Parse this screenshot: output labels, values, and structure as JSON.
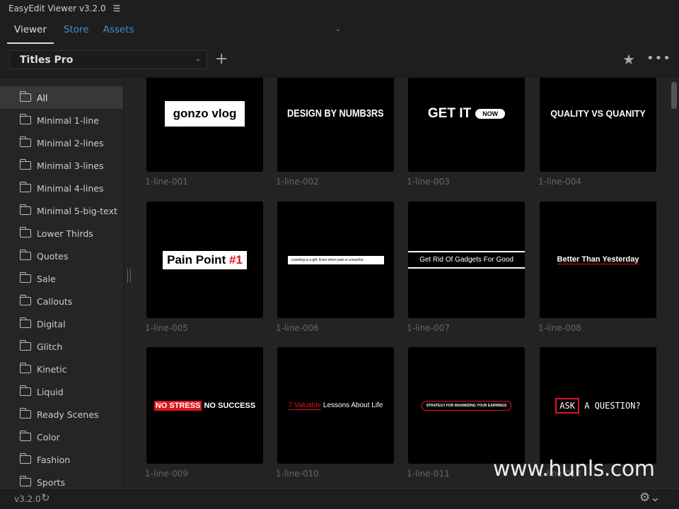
{
  "app": {
    "title": "EasyEdit Viewer v3.2.0",
    "version": "v3.2.0"
  },
  "tabs": [
    {
      "label": "Viewer",
      "active": true
    },
    {
      "label": "Store"
    },
    {
      "label": "Assets"
    }
  ],
  "toolbar": {
    "collection": "Titles Pro"
  },
  "sidebar": {
    "items": [
      "All",
      "Minimal 1-line",
      "Minimal 2-lines",
      "Minimal 3-lines",
      "Minimal 4-lines",
      "Minimal 5-big-text",
      "Lower Thirds",
      "Quotes",
      "Sale",
      "Callouts",
      "Digital",
      "Glitch",
      "Kinetic",
      "Liquid",
      "Ready Scenes",
      "Color",
      "Fashion",
      "Sports"
    ],
    "active": "All"
  },
  "assets": [
    {
      "name": "1-line-001",
      "preview": "gonzo vlog"
    },
    {
      "name": "1-line-002",
      "preview": "DESIGN BY NUMB3RS"
    },
    {
      "name": "1-line-003",
      "preview": "GET IT",
      "badge": "NOW"
    },
    {
      "name": "1-line-004",
      "preview": "QUALITY VS QUANITY"
    },
    {
      "name": "1-line-005",
      "preview": "Pain Point",
      "accent": "#1"
    },
    {
      "name": "1-line-006",
      "preview": "Learning is a gift. Even when pain is a teacher."
    },
    {
      "name": "1-line-007",
      "preview": "Get Rid Of Gadgets For Good"
    },
    {
      "name": "1-line-008",
      "preview": "Better Than Yesterday"
    },
    {
      "name": "1-line-009",
      "preview": "NO STRESS",
      "accent": "NO SUCCESS"
    },
    {
      "name": "1-line-010",
      "preview": "7 Valuable",
      "accent": "Lessons About Life"
    },
    {
      "name": "1-line-011",
      "preview": "STRATEGY FOR MAXIMIZING YOUR EARNINGS"
    },
    {
      "name": "1-line-012",
      "preview": "ASK",
      "accent": "A QUESTION?"
    }
  ],
  "watermark": "www.hunls.com",
  "colors": {
    "accent_red": "#e0141e",
    "link_blue": "#3d8fd6"
  }
}
